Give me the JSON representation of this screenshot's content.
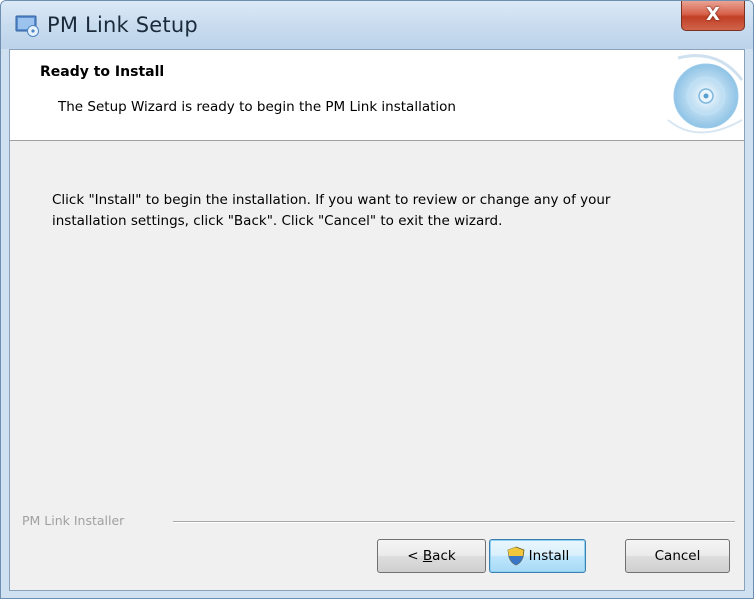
{
  "window": {
    "title": "PM Link Setup",
    "close_glyph": "X"
  },
  "banner": {
    "title": "Ready to Install",
    "subtitle": "The Setup Wizard is ready to begin the PM Link installation",
    "graphic_icon": "setup-disc-graphic"
  },
  "body": {
    "instructions": "Click \"Install\" to begin the installation.  If you want to review or change any of your\ninstallation settings, click \"Back\".  Click \"Cancel\" to exit the wizard."
  },
  "footer": {
    "installer_label": "PM Link Installer",
    "buttons": {
      "back_prefix": "< ",
      "back_mnemonic": "B",
      "back_rest": "ack",
      "install": "Install",
      "install_icon": "uac-shield-icon",
      "cancel": "Cancel"
    }
  },
  "colors": {
    "titlebar": "#c9dcef",
    "close_button": "#c13f25",
    "install_button_border": "#3c7fb1"
  }
}
